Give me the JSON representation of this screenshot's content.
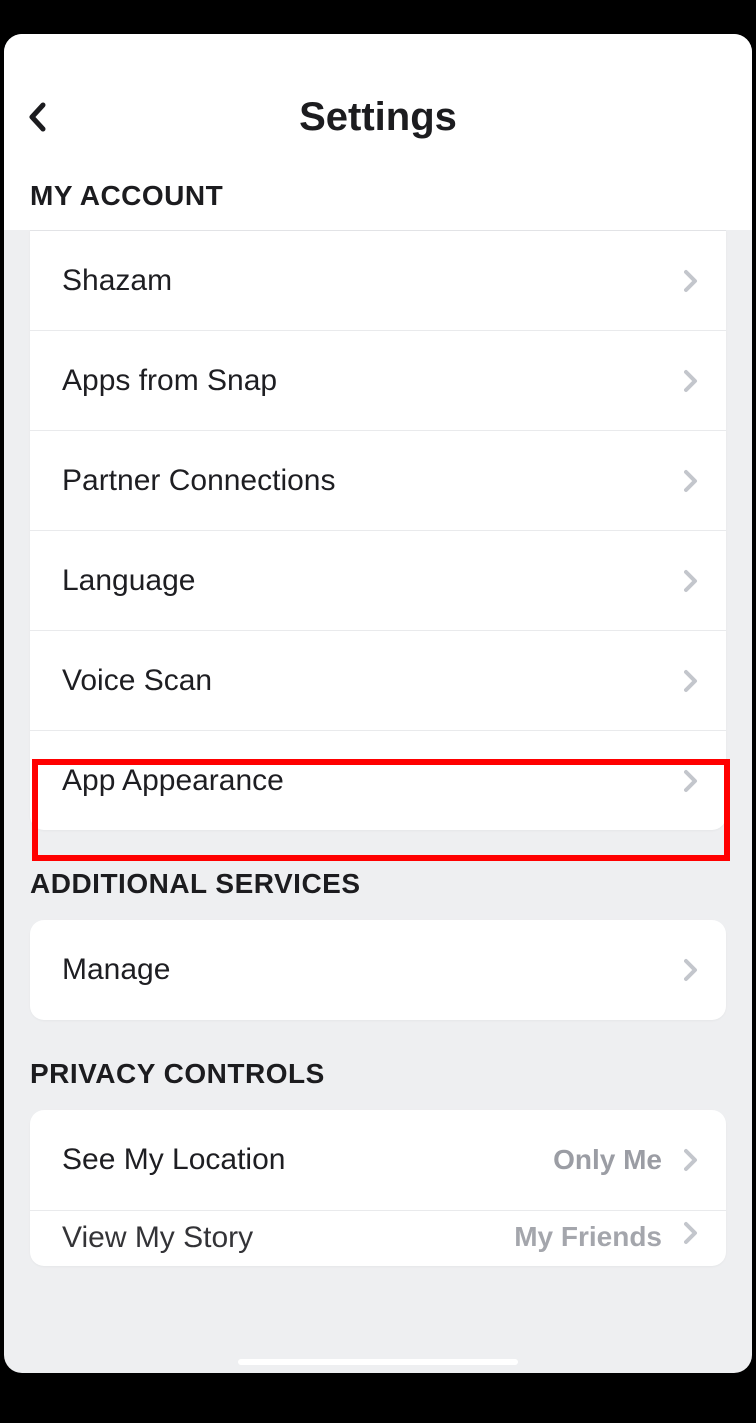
{
  "header": {
    "title": "Settings"
  },
  "sections": {
    "account": {
      "title": "MY ACCOUNT",
      "items": [
        {
          "label": "Shazam"
        },
        {
          "label": "Apps from Snap"
        },
        {
          "label": "Partner Connections"
        },
        {
          "label": "Language"
        },
        {
          "label": "Voice Scan"
        },
        {
          "label": "App Appearance"
        }
      ]
    },
    "additional": {
      "title": "ADDITIONAL SERVICES",
      "items": [
        {
          "label": "Manage"
        }
      ]
    },
    "privacy": {
      "title": "PRIVACY CONTROLS",
      "items": [
        {
          "label": "See My Location",
          "value": "Only Me"
        },
        {
          "label": "View My Story",
          "value": "My Friends"
        }
      ]
    }
  }
}
